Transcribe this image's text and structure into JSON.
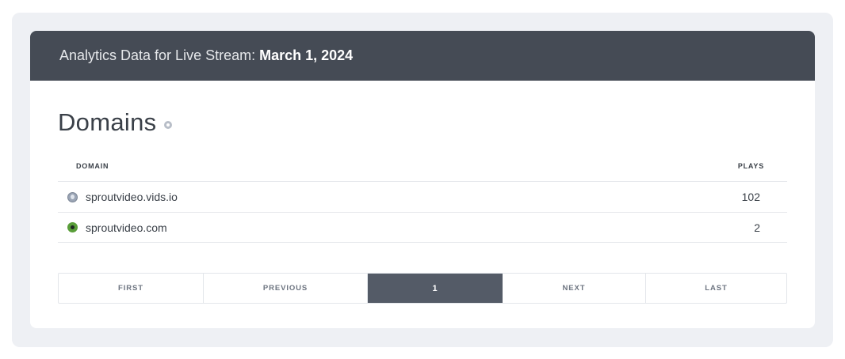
{
  "header": {
    "title_prefix": "Analytics Data for Live Stream:",
    "title_date": "March 1, 2024"
  },
  "section": {
    "title": "Domains",
    "help_icon": "help-icon"
  },
  "table": {
    "columns": {
      "domain": "DOMAIN",
      "plays": "PLAYS"
    },
    "rows": [
      {
        "domain": "sproutvideo.vids.io",
        "plays": "102",
        "icon": "globe-icon"
      },
      {
        "domain": "sproutvideo.com",
        "plays": "2",
        "icon": "sproutvideo-logo-icon"
      }
    ]
  },
  "pagination": {
    "first": "FIRST",
    "previous": "PREVIOUS",
    "current": "1",
    "next": "NEXT",
    "last": "LAST"
  },
  "colors": {
    "header_bg": "#454b55",
    "active_page_bg": "#545b67",
    "outer_bg": "#eef0f4"
  }
}
